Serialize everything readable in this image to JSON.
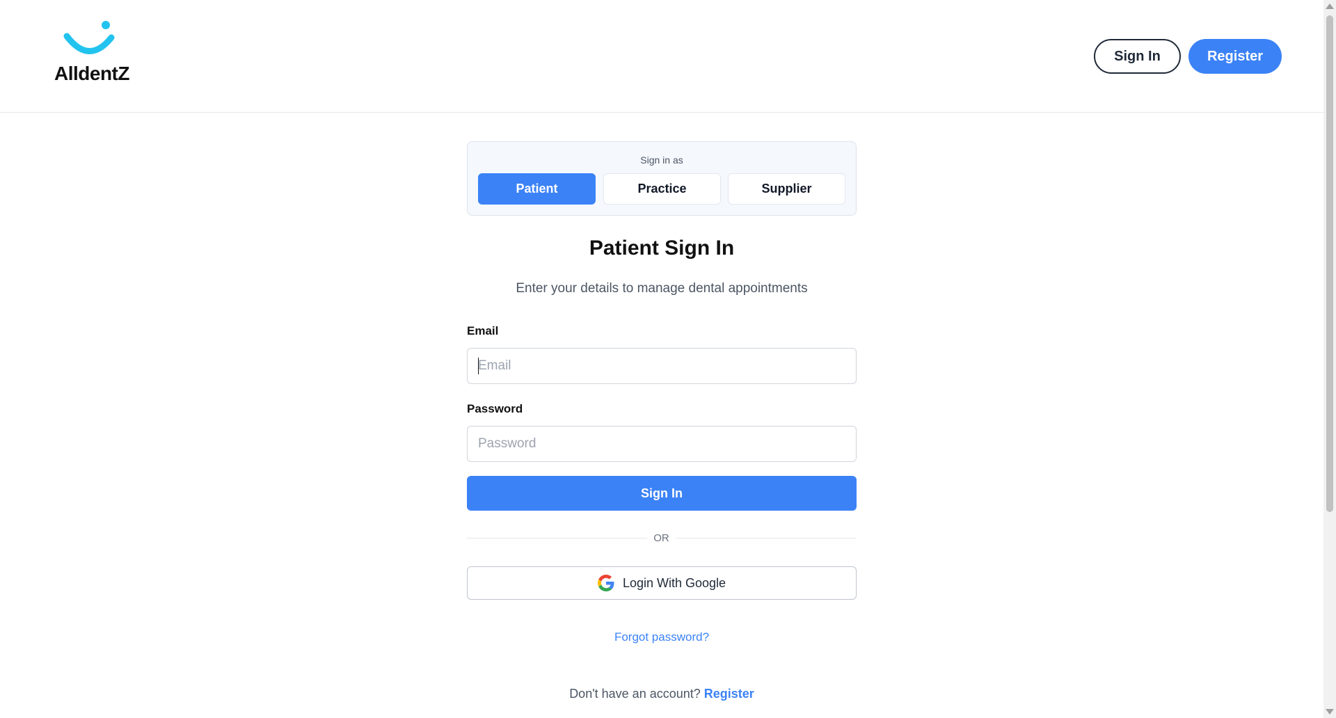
{
  "brand": {
    "name": "AlldentZ",
    "logo_icon": "smile-logo-icon",
    "accent": "#22c3ee"
  },
  "header": {
    "signin_label": "Sign In",
    "register_label": "Register"
  },
  "role_selector": {
    "caption": "Sign in as",
    "tabs": [
      {
        "label": "Patient",
        "active": true
      },
      {
        "label": "Practice",
        "active": false
      },
      {
        "label": "Supplier",
        "active": false
      }
    ]
  },
  "form": {
    "title": "Patient Sign In",
    "subtitle": "Enter your details to manage dental appointments",
    "email_label": "Email",
    "email_placeholder": "Email",
    "password_label": "Password",
    "password_placeholder": "Password",
    "submit_label": "Sign In",
    "or_text": "OR",
    "google_label": "Login With Google",
    "forgot_label": "Forgot password?",
    "no_account_text": "Don't have an account?",
    "register_link": "Register"
  },
  "colors": {
    "primary": "#3b82f6",
    "text": "#111827",
    "muted": "#4b5563"
  }
}
